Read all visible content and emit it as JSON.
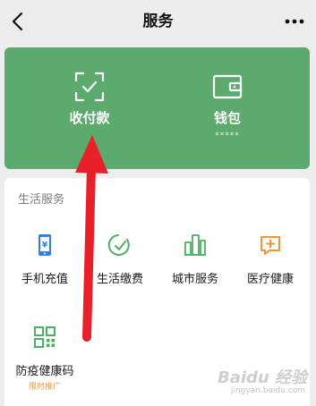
{
  "header": {
    "title": "服务",
    "back_icon": "chevron-left-icon",
    "more_icon": "more-horizontal-icon"
  },
  "top_card": {
    "bg_color": "#5daa6f",
    "items": [
      {
        "label": "收付款",
        "icon": "scan-check-icon"
      },
      {
        "label": "钱包",
        "sub": "*****",
        "icon": "wallet-icon"
      }
    ]
  },
  "life_services": {
    "title": "生活服务",
    "items": [
      {
        "label": "手机充值",
        "icon": "mobile-topup-icon",
        "color": "#2f7fe6"
      },
      {
        "label": "生活缴费",
        "icon": "utility-payment-icon",
        "color": "#4caf64"
      },
      {
        "label": "城市服务",
        "icon": "city-services-icon",
        "color": "#4caf64"
      },
      {
        "label": "医疗健康",
        "icon": "medical-health-icon",
        "color": "#f0963a"
      },
      {
        "label": "防疫健康码",
        "tag": "限时推广",
        "icon": "health-code-icon",
        "color": "#4caf64"
      }
    ]
  },
  "annotation": {
    "arrow_color": "#e8202a"
  },
  "watermark": {
    "brand": "Baidu 经验",
    "url": "jingyan.baidu.com"
  }
}
